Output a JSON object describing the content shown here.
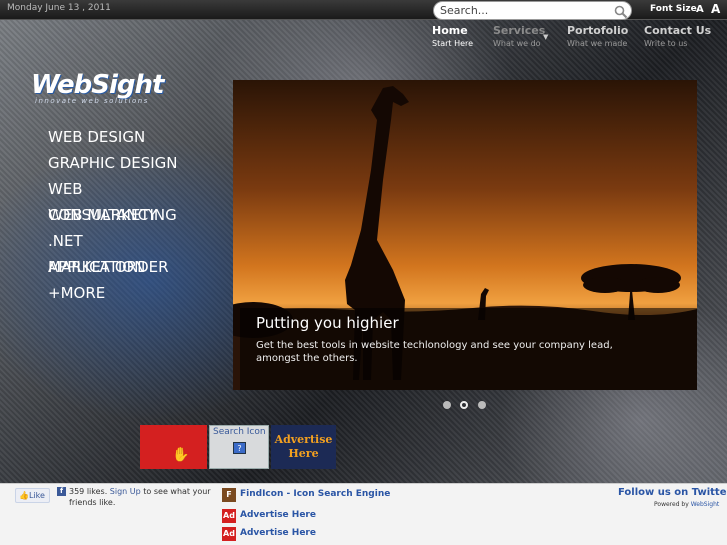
{
  "topbar": {
    "date": "Monday June 13 , 2011",
    "search_placeholder": "Search...",
    "font_size_label": "Font Size",
    "font_small": "A",
    "font_large": "A"
  },
  "nav": [
    {
      "title": "Home",
      "sub": "Start Here"
    },
    {
      "title": "Services",
      "sub": "What we do"
    },
    {
      "title": "Portofolio",
      "sub": "What we made"
    },
    {
      "title": "Contact Us",
      "sub": "Write to us"
    }
  ],
  "logo": {
    "name": "WebSight",
    "tagline": "innovate web solutions"
  },
  "menu": [
    "WEB DESIGN",
    "GRAPHIC DESIGN",
    "WEB",
    "CONSULTANCY",
    "WEB MARKETING",
    ".NET",
    "APPLICATION",
    "MARKET ORDER",
    "+MORE"
  ],
  "slider": {
    "title": "Putting you highier",
    "text": "Get the best tools in website techlonology and see your company lead, amongst the others.",
    "slide_count": 3,
    "active_slide": 2
  },
  "tiles": {
    "search_label": "Search Icon",
    "search_icon_glyph": "?",
    "advertise_line1": "Advertise",
    "advertise_line2": "Here",
    "red_glyph": "✋"
  },
  "footer": {
    "like_label": "Like",
    "fb_count": "359 likes.",
    "fb_signup": "Sign Up",
    "fb_rest": "to see what your friends like.",
    "sponsors": [
      {
        "icon": "F",
        "text": "FindIcon - Icon Search Engine"
      },
      {
        "icon": "Ad",
        "text": "Advertise Here"
      },
      {
        "icon": "Ad",
        "text": "Advertise Here"
      }
    ],
    "follow": "Follow us on Twitter",
    "powered_prefix": "Powered by",
    "powered_link": "WebSight"
  },
  "colors": {
    "accent_blue": "#2a55a5",
    "facebook_blue": "#3b5998",
    "ad_red": "#d42020",
    "ad_orange": "#f2a020"
  }
}
